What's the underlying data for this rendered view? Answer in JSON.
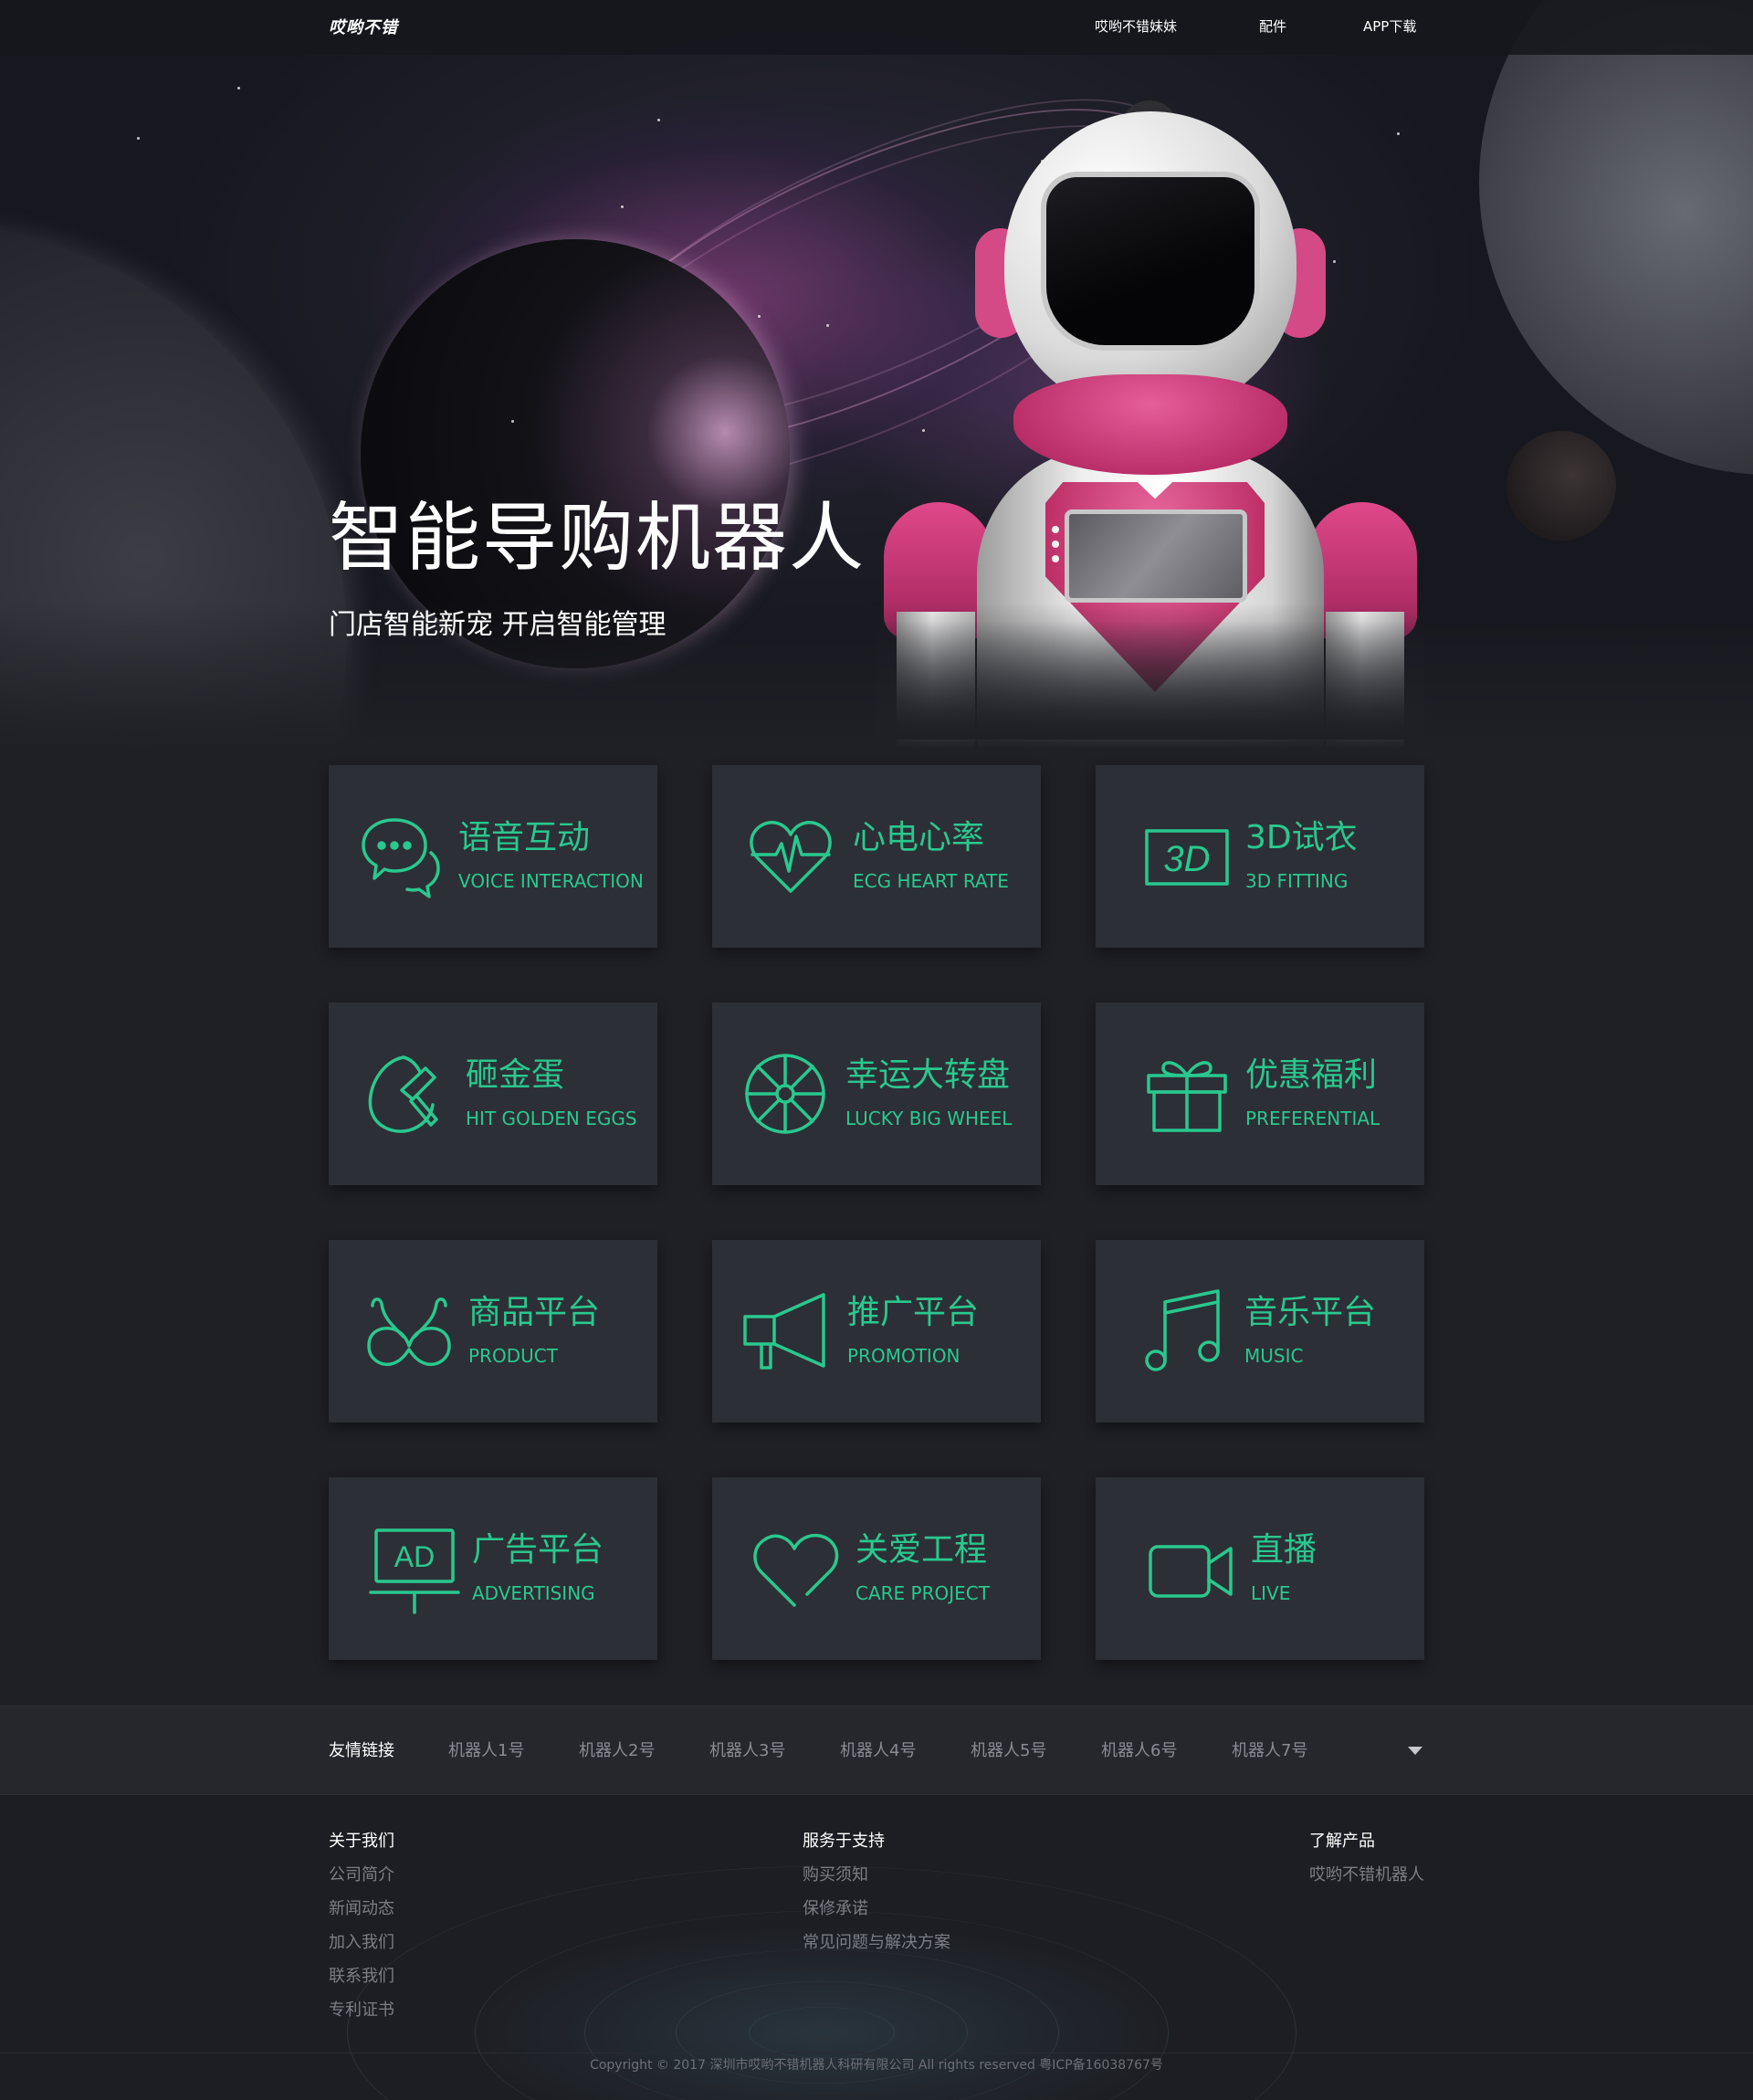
{
  "nav": {
    "logo_text": "哎哟不错",
    "links": [
      "哎哟不错妹妹",
      "配件",
      "APP下载"
    ]
  },
  "hero": {
    "title": "智能导购机器人",
    "subtitle": "门店智能新宠 开启智能管理"
  },
  "features": [
    {
      "title": "语音互动",
      "subtitle": "VOICE INTERACTION",
      "icon": "speech-bubbles-icon"
    },
    {
      "title": "心电心率",
      "subtitle": "ECG HEART RATE",
      "icon": "heart-pulse-icon"
    },
    {
      "title": "3D试衣",
      "subtitle": "3D FITTING",
      "icon": "3d-box-icon",
      "icon_text": "3D"
    },
    {
      "title": "砸金蛋",
      "subtitle": "HIT GOLDEN EGGS",
      "icon": "egg-hammer-icon"
    },
    {
      "title": "幸运大转盘",
      "subtitle": "LUCKY BIG WHEEL",
      "icon": "wheel-icon"
    },
    {
      "title": "优惠福利",
      "subtitle": "PREFERENTIAL",
      "icon": "gift-icon"
    },
    {
      "title": "商品平台",
      "subtitle": "PRODUCT",
      "icon": "bra-icon"
    },
    {
      "title": "推广平台",
      "subtitle": "PROMOTION",
      "icon": "megaphone-icon"
    },
    {
      "title": "音乐平台",
      "subtitle": "MUSIC",
      "icon": "music-note-icon"
    },
    {
      "title": "广告平台",
      "subtitle": "ADVERTISING",
      "icon": "billboard-icon",
      "icon_text": "AD"
    },
    {
      "title": "关爱工程",
      "subtitle": "CARE PROJECT",
      "icon": "heart-outline-icon"
    },
    {
      "title": "直播",
      "subtitle": "LIVE",
      "icon": "video-camera-icon"
    }
  ],
  "friend_links": {
    "label": "友情链接",
    "items": [
      "机器人1号",
      "机器人2号",
      "机器人3号",
      "机器人4号",
      "机器人5号",
      "机器人6号",
      "机器人7号"
    ]
  },
  "footer": {
    "columns": [
      {
        "heading": "关于我们",
        "items": [
          "公司简介",
          "新闻动态",
          "加入我们",
          "联系我们",
          "专利证书"
        ]
      },
      {
        "heading": "服务于支持",
        "items": [
          "购买须知",
          "保修承诺",
          "常见问题与解决方案"
        ]
      },
      {
        "heading": "了解产品",
        "items": [
          "哎哟不错机器人"
        ]
      }
    ],
    "copyright": "Copyright © 2017 深圳市哎哟不错机器人科研有限公司 All rights reserved 粤ICP备16038767号"
  },
  "colors": {
    "accent": "#29c88f",
    "card_bg": "#2d2f36",
    "page_bg": "#1f2026"
  }
}
